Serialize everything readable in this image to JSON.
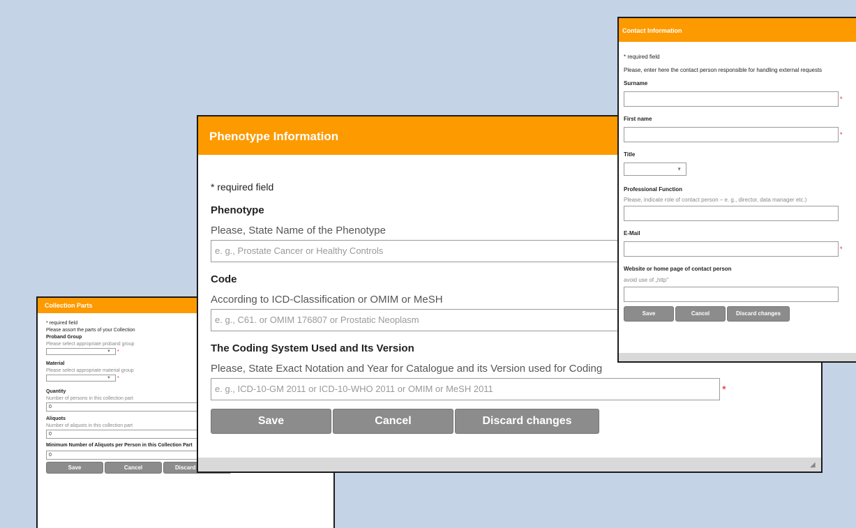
{
  "collection_dialog": {
    "title": "Collection Parts",
    "required_note": "* required field",
    "instruction": "Please assort the parts of your Collection",
    "proband_group": {
      "label": "Proband Group",
      "hint": "Please select appropriate proband group",
      "value": ""
    },
    "material": {
      "label": "Material",
      "hint": "Please select appropriate material group",
      "value": ""
    },
    "quantity": {
      "label": "Quantity",
      "hint": "Number of persons in this collection part",
      "value": "0"
    },
    "aliquots": {
      "label": "Aliquots",
      "hint": "Number of aliquots in this collection part",
      "value": "0"
    },
    "min_aliquots": {
      "label": "Minimum Number of Aliquots per Person in this Collection Part",
      "value": "0"
    },
    "buttons": {
      "save": "Save",
      "cancel": "Cancel",
      "discard": "Discard changes"
    }
  },
  "phenotype_dialog": {
    "title": "Phenotype Information",
    "required_note": "* required field",
    "phenotype": {
      "heading": "Phenotype",
      "prompt": "Please, State Name of the Phenotype",
      "placeholder": "e. g., Prostate Cancer or Healthy  Controls"
    },
    "code": {
      "heading": "Code",
      "prompt": "According to ICD-Classification or OMIM or MeSH",
      "placeholder": "e. g., C61. or OMIM 176807 or Prostatic Neoplasm"
    },
    "coding_system": {
      "heading": "The Coding System Used and Its Version",
      "prompt": "Please, State Exact Notation and Year for Catalogue and its Version used for Coding",
      "placeholder": "e. g., ICD-10-GM 2011 or ICD-10-WHO 2011 or OMIM or MeSH 2011"
    },
    "buttons": {
      "save": "Save",
      "cancel": "Cancel",
      "discard": "Discard changes"
    }
  },
  "contact_dialog": {
    "title": "Contact Information",
    "required_note": "* required field",
    "instruction": "Please, enter here the contact person responsible for handling external requests",
    "surname": {
      "label": "Surname",
      "value": ""
    },
    "first_name": {
      "label": "First name",
      "value": ""
    },
    "title_field": {
      "label": "Title",
      "value": ""
    },
    "professional_function": {
      "label": "Professional Function",
      "hint": "Please, indicate role of contact person – e. g., director, data manager etc.)",
      "value": ""
    },
    "email": {
      "label": "E-Mail",
      "value": ""
    },
    "website": {
      "label": "Website or home page of contact person",
      "hint": "avoid use of „http\"",
      "value": ""
    },
    "buttons": {
      "save": "Save",
      "cancel": "Cancel",
      "discard": "Discard changes"
    }
  },
  "required_marker": "*",
  "colors": {
    "background": "#c5d3e6",
    "header_orange": "#fd9a00",
    "button_gray": "#8c8c8c",
    "required_red": "#e02020"
  }
}
